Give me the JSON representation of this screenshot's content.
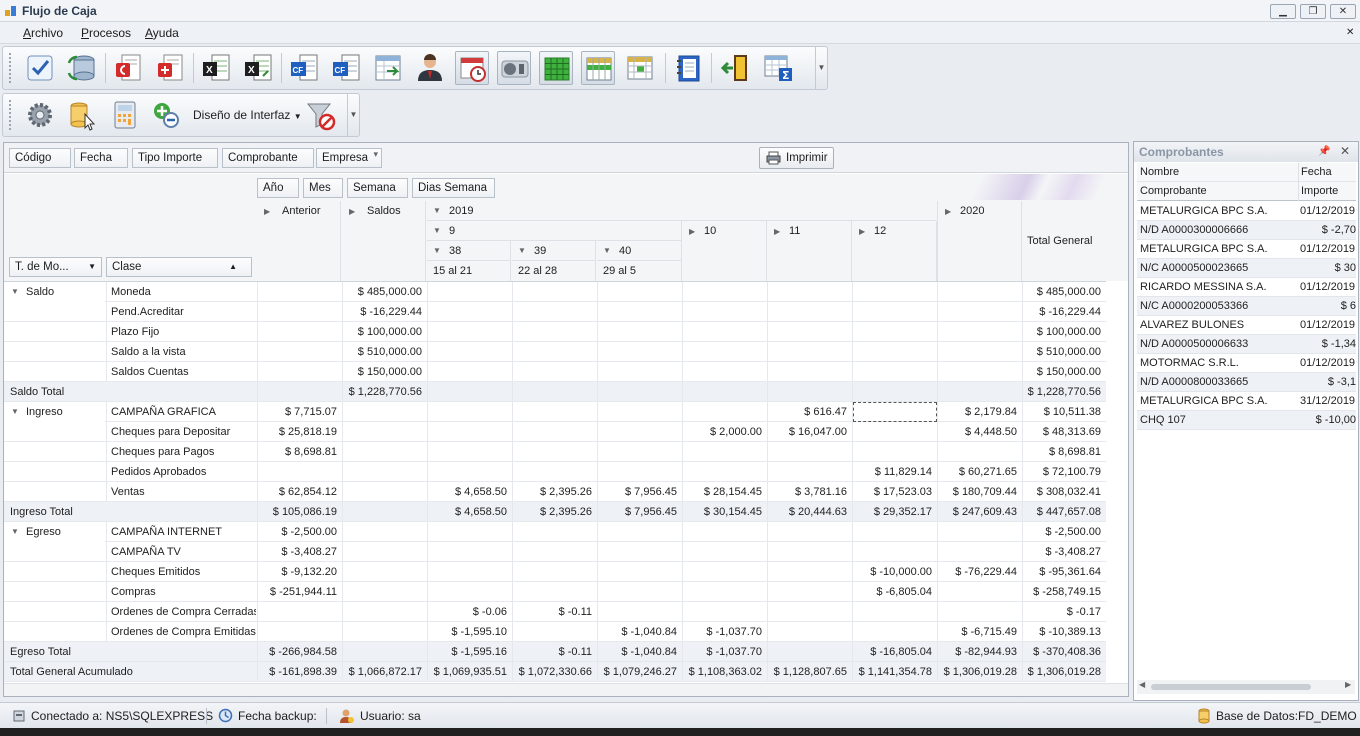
{
  "window": {
    "title": "Flujo de Caja"
  },
  "menu": [
    "Archivo",
    "Procesos",
    "Ayuda"
  ],
  "toolbar2": {
    "design_label": "Diseño de Interfaz"
  },
  "filters": [
    "Código",
    "Fecha",
    "Tipo Importe",
    "Comprobante",
    "Empresa"
  ],
  "print_label": "Imprimir",
  "date_fields": [
    "Año",
    "Mes",
    "Semana",
    "Dias Semana"
  ],
  "row_fields": [
    "T. de Mo...",
    "Clase"
  ],
  "columns": {
    "anterior": "Anterior",
    "saldos": "Saldos",
    "y2019": "2019",
    "m9": "9",
    "w38": "38",
    "w39": "39",
    "w40": "40",
    "d38": "15 al 21",
    "d39": "22 al 28",
    "d40": "29 al 5",
    "m10": "10",
    "m11": "11",
    "m12": "12",
    "y2020": "2020",
    "total": "Total General"
  },
  "groups": {
    "saldo": "Saldo",
    "ingreso": "Ingreso",
    "egreso": "Egreso"
  },
  "rows": [
    {
      "label": "Moneda",
      "v": [
        "",
        "$ 485,000.00",
        "",
        "",
        "",
        "",
        "",
        "",
        "",
        "$ 485,000.00"
      ]
    },
    {
      "label": "Pend.Acreditar",
      "v": [
        "",
        "$ -16,229.44",
        "",
        "",
        "",
        "",
        "",
        "",
        "",
        "$ -16,229.44"
      ]
    },
    {
      "label": "Plazo Fijo",
      "v": [
        "",
        "$ 100,000.00",
        "",
        "",
        "",
        "",
        "",
        "",
        "",
        "$ 100,000.00"
      ]
    },
    {
      "label": "Saldo a la vista",
      "v": [
        "",
        "$ 510,000.00",
        "",
        "",
        "",
        "",
        "",
        "",
        "",
        "$ 510,000.00"
      ]
    },
    {
      "label": "Saldos Cuentas",
      "v": [
        "",
        "$ 150,000.00",
        "",
        "",
        "",
        "",
        "",
        "",
        "",
        "$ 150,000.00"
      ]
    },
    {
      "label": "Saldo Total",
      "total": true,
      "v": [
        "",
        "$ 1,228,770.56",
        "",
        "",
        "",
        "",
        "",
        "",
        "",
        "$ 1,228,770.56"
      ]
    },
    {
      "label": "CAMPAÑA GRAFICA",
      "v": [
        "$ 7,715.07",
        "",
        "",
        "",
        "",
        "",
        "$ 616.47",
        "",
        "$ 2,179.84",
        "$ 10,511.38"
      ]
    },
    {
      "label": "Cheques para Depositar",
      "v": [
        "$ 25,818.19",
        "",
        "",
        "",
        "",
        "$ 2,000.00",
        "$ 16,047.00",
        "",
        "$ 4,448.50",
        "$ 48,313.69"
      ]
    },
    {
      "label": "Cheques para Pagos",
      "v": [
        "$ 8,698.81",
        "",
        "",
        "",
        "",
        "",
        "",
        "",
        "",
        "$ 8,698.81"
      ]
    },
    {
      "label": "Pedidos Aprobados",
      "v": [
        "",
        "",
        "",
        "",
        "",
        "",
        "",
        "$ 11,829.14",
        "$ 60,271.65",
        "$ 72,100.79"
      ]
    },
    {
      "label": "Ventas",
      "v": [
        "$ 62,854.12",
        "",
        "$ 4,658.50",
        "$ 2,395.26",
        "$ 7,956.45",
        "$ 28,154.45",
        "$ 3,781.16",
        "$ 17,523.03",
        "$ 180,709.44",
        "$ 308,032.41"
      ]
    },
    {
      "label": "Ingreso Total",
      "total": true,
      "v": [
        "$ 105,086.19",
        "",
        "$ 4,658.50",
        "$ 2,395.26",
        "$ 7,956.45",
        "$ 30,154.45",
        "$ 20,444.63",
        "$ 29,352.17",
        "$ 247,609.43",
        "$ 447,657.08"
      ]
    },
    {
      "label": "CAMPAÑA INTERNET",
      "v": [
        "$ -2,500.00",
        "",
        "",
        "",
        "",
        "",
        "",
        "",
        "",
        "$ -2,500.00"
      ]
    },
    {
      "label": "CAMPAÑA TV",
      "v": [
        "$ -3,408.27",
        "",
        "",
        "",
        "",
        "",
        "",
        "",
        "",
        "$ -3,408.27"
      ]
    },
    {
      "label": "Cheques Emitidos",
      "v": [
        "$ -9,132.20",
        "",
        "",
        "",
        "",
        "",
        "",
        "$ -10,000.00",
        "$ -76,229.44",
        "$ -95,361.64"
      ]
    },
    {
      "label": "Compras",
      "v": [
        "$ -251,944.11",
        "",
        "",
        "",
        "",
        "",
        "",
        "$ -6,805.04",
        "",
        "$ -258,749.15"
      ]
    },
    {
      "label": "Ordenes de Compra Cerradas",
      "v": [
        "",
        "",
        "$ -0.06",
        "$ -0.11",
        "",
        "",
        "",
        "",
        "",
        "$ -0.17"
      ]
    },
    {
      "label": "Ordenes de Compra Emitidas",
      "v": [
        "",
        "",
        "$ -1,595.10",
        "",
        "$ -1,040.84",
        "$ -1,037.70",
        "",
        "",
        "$ -6,715.49",
        "$ -10,389.13"
      ]
    },
    {
      "label": "Egreso Total",
      "total": true,
      "v": [
        "$ -266,984.58",
        "",
        "$ -1,595.16",
        "$ -0.11",
        "$ -1,040.84",
        "$ -1,037.70",
        "",
        "$ -16,805.04",
        "$ -82,944.93",
        "$ -370,408.36"
      ]
    },
    {
      "label": "Total General Acumulado",
      "total": true,
      "v": [
        "$ -161,898.39",
        "$ 1,066,872.17",
        "$ 1,069,935.51",
        "$ 1,072,330.66",
        "$ 1,079,246.27",
        "$ 1,108,363.02",
        "$ 1,128,807.65",
        "$ 1,141,354.78",
        "$ 1,306,019.28",
        "$ 1,306,019.28"
      ]
    }
  ],
  "comprobantes": {
    "title": "Comprobantes",
    "headers": [
      "Nombre",
      "Fecha",
      "Comprobante",
      "Importe"
    ],
    "rows": [
      [
        "METALURGICA BPC S.A.",
        "01/12/2019"
      ],
      [
        "N/D A0000300006666",
        "$ -2,70"
      ],
      [
        "METALURGICA BPC S.A.",
        "01/12/2019"
      ],
      [
        "N/C A0000500023665",
        "$ 30"
      ],
      [
        "RICARDO MESSINA S.A.",
        "01/12/2019"
      ],
      [
        "N/C A0000200053366",
        "$ 6"
      ],
      [
        "ALVAREZ BULONES",
        "01/12/2019"
      ],
      [
        "N/D A0000500006633",
        "$ -1,34"
      ],
      [
        "MOTORMAC S.R.L.",
        "01/12/2019"
      ],
      [
        "N/D A0000800033665",
        "$ -3,1"
      ],
      [
        "METALURGICA BPC S.A.",
        "31/12/2019"
      ],
      [
        "CHQ 107",
        "$ -10,00"
      ]
    ]
  },
  "status": {
    "connected": "Conectado a: NS5\\SQLEXPRESS",
    "backup": "Fecha backup:",
    "user": "Usuario: sa",
    "db": "Base de Datos:FD_DEMO"
  }
}
